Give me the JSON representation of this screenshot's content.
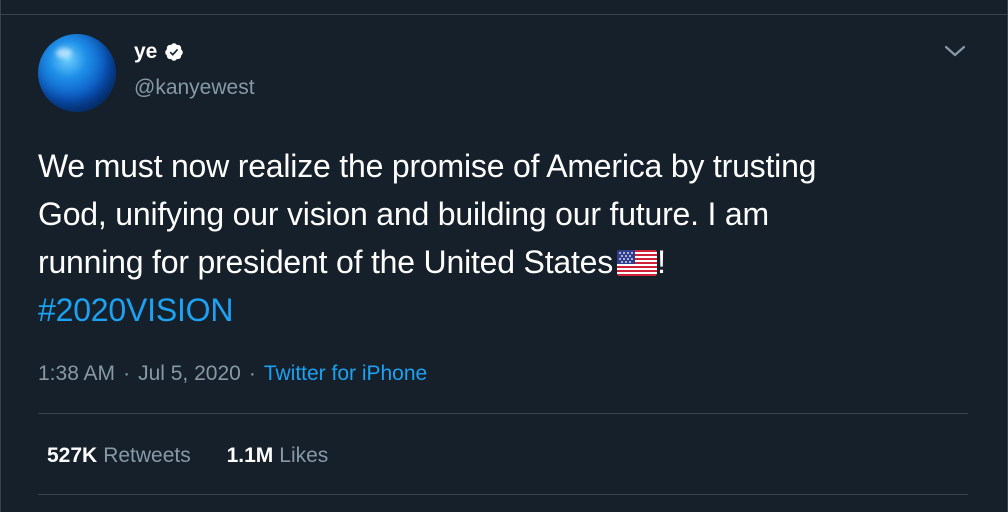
{
  "user": {
    "display_name": "ye",
    "handle": "@kanyewest",
    "verified": true
  },
  "tweet": {
    "line1": "We must now realize the promise of America by trusting",
    "line2": "God, unifying our vision and building our future. I am",
    "line3": "running for president of the United States",
    "flag_icon": "us-flag-emoji",
    "exclamation": "!",
    "hashtag": "#2020VISION"
  },
  "meta": {
    "time": "1:38 AM",
    "separator": "·",
    "date": "Jul 5, 2020",
    "source": "Twitter for iPhone"
  },
  "stats": {
    "retweets_count": "527K",
    "retweets_label": "Retweets",
    "likes_count": "1.1M",
    "likes_label": "Likes"
  },
  "colors": {
    "background": "#15202b",
    "accent": "#1da1f2",
    "muted_text": "#8899a6",
    "divider": "#38444d"
  },
  "icons": {
    "more_menu": "chevron-down-icon",
    "verified": "verified-badge-icon"
  }
}
